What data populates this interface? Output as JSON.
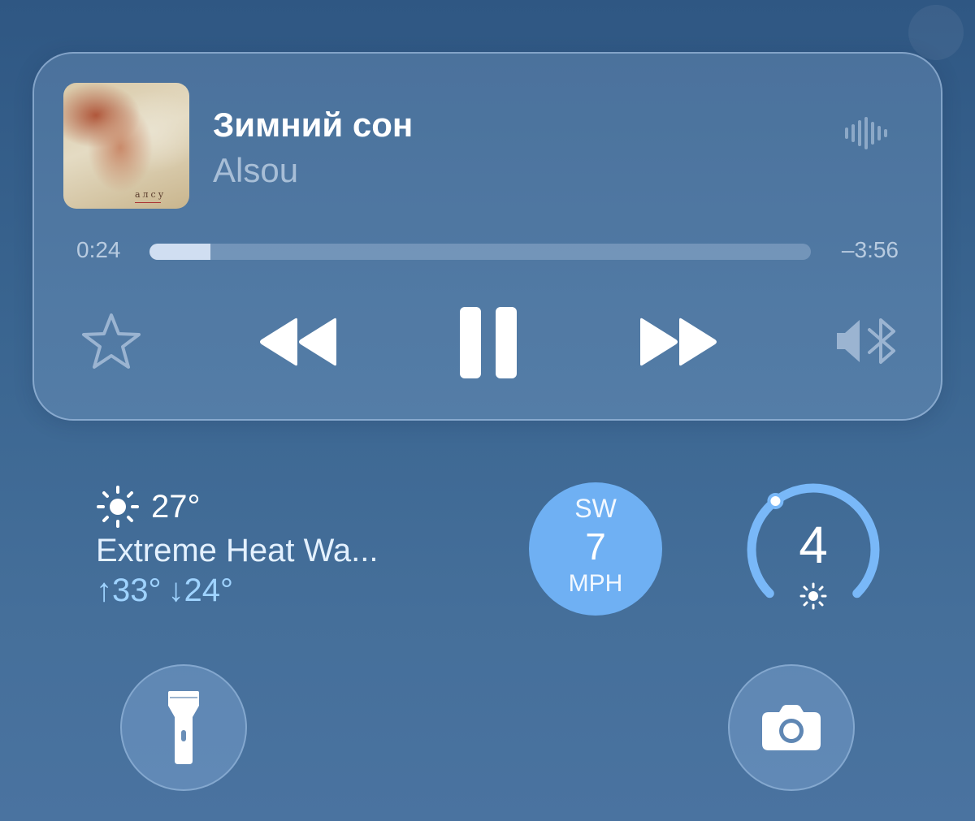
{
  "now_playing": {
    "title": "Зимний сон",
    "artist": "Alsou",
    "album_art_text": "алсу",
    "elapsed": "0:24",
    "remaining": "–3:56",
    "progress": 0.092,
    "controls": {
      "favorite": "star-icon",
      "previous": "rewind-icon",
      "play_pause": "pause-icon",
      "next": "fast-forward-icon",
      "output": "speaker-bluetooth-icon"
    }
  },
  "weather": {
    "temperature": "27°",
    "condition": "Extreme Heat Wa...",
    "high": "↑33°",
    "low": "↓24°",
    "icon": "sun-icon"
  },
  "wind": {
    "direction": "SW",
    "speed": "7",
    "unit": "MPH"
  },
  "uv_index": {
    "value": "4",
    "level": 0.36,
    "icon": "sun-icon"
  },
  "quick_actions": {
    "flashlight": "flashlight-icon",
    "camera": "camera-icon"
  },
  "colors": {
    "background": "#3a6590",
    "accent_blue": "#6fb0f3",
    "range_text": "#9fd3ff",
    "gauge_arc": "#79b8f8"
  }
}
